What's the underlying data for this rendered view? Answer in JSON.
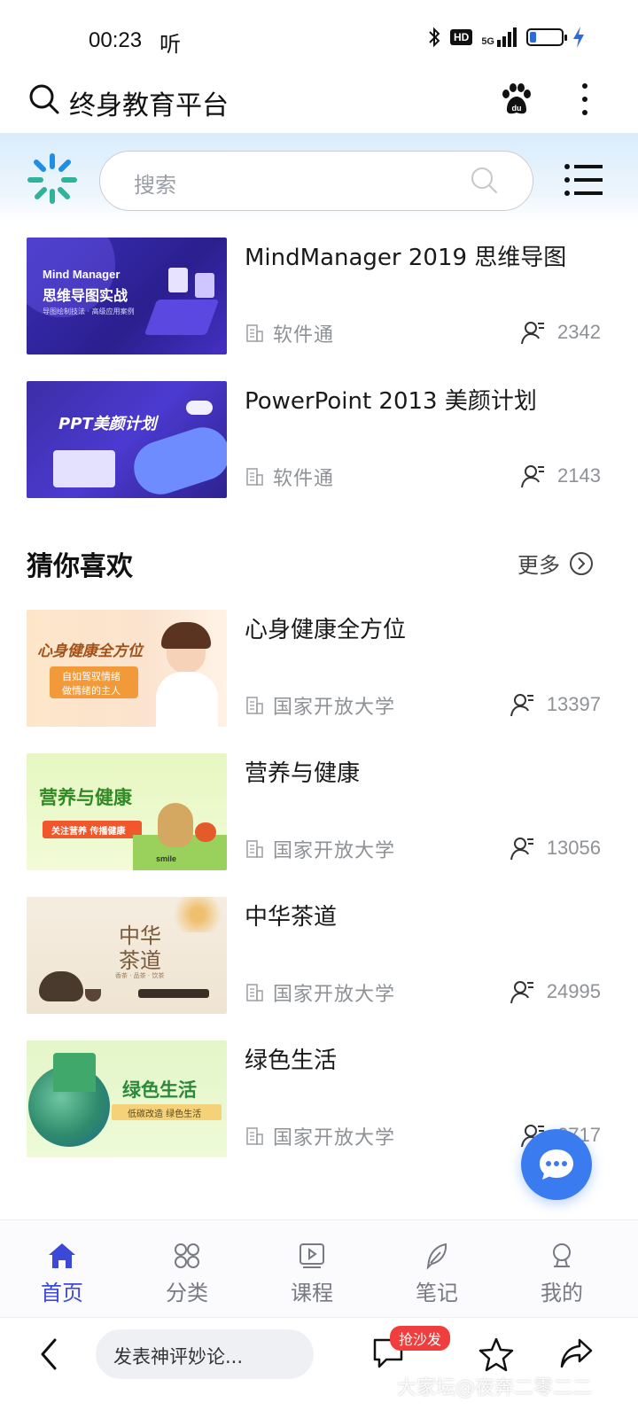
{
  "status_bar": {
    "time": "00:23",
    "audio_label": "听",
    "hd_label": "HD",
    "network_label": "5G",
    "battery_level_percent": 20
  },
  "browser": {
    "title": "终身教育平台"
  },
  "header": {
    "search_placeholder": "搜索"
  },
  "featured_courses": [
    {
      "title": "MindManager 2019 思维导图",
      "provider": "软件通",
      "count": "2342",
      "thumb_texts": [
        "Mind Manager",
        "思维导图实战",
        "导图绘制技法 · 高级应用案例"
      ]
    },
    {
      "title": "PowerPoint 2013 美颜计划",
      "provider": "软件通",
      "count": "2143",
      "thumb_texts": [
        "PPT美颜计划"
      ]
    }
  ],
  "section": {
    "title": "猜你喜欢",
    "more_label": "更多"
  },
  "recommended_courses": [
    {
      "title": "心身健康全方位",
      "provider": "国家开放大学",
      "count": "13397",
      "thumb_texts": [
        "心身健康全方位",
        "自如驾驭情绪",
        "做情绪的主人"
      ]
    },
    {
      "title": "营养与健康",
      "provider": "国家开放大学",
      "count": "13056",
      "thumb_texts": [
        "营养与健康",
        "关注营养 传播健康",
        "smile"
      ]
    },
    {
      "title": "中华茶道",
      "provider": "国家开放大学",
      "count": "24995",
      "thumb_texts": [
        "中华",
        "茶道",
        "香茶 · 品茶 · 饮茶"
      ]
    },
    {
      "title": "绿色生活",
      "provider": "国家开放大学",
      "count": "2717",
      "thumb_texts": [
        "绿色生活",
        "低碳改造 绿色生活"
      ]
    }
  ],
  "bottom_nav": [
    {
      "label": "首页",
      "icon": "home-icon",
      "active": true
    },
    {
      "label": "分类",
      "icon": "category-icon",
      "active": false
    },
    {
      "label": "课程",
      "icon": "course-icon",
      "active": false
    },
    {
      "label": "笔记",
      "icon": "notes-icon",
      "active": false
    },
    {
      "label": "我的",
      "icon": "profile-icon",
      "active": false
    }
  ],
  "browser_bar": {
    "comment_placeholder": "发表神评妙论...",
    "sofa_badge": "抢沙发",
    "watermark": "大家坛@夜奔二零二二"
  },
  "colors": {
    "accent": "#3b49d6",
    "fab": "#3a7bf0",
    "badge": "#f03e3e"
  }
}
